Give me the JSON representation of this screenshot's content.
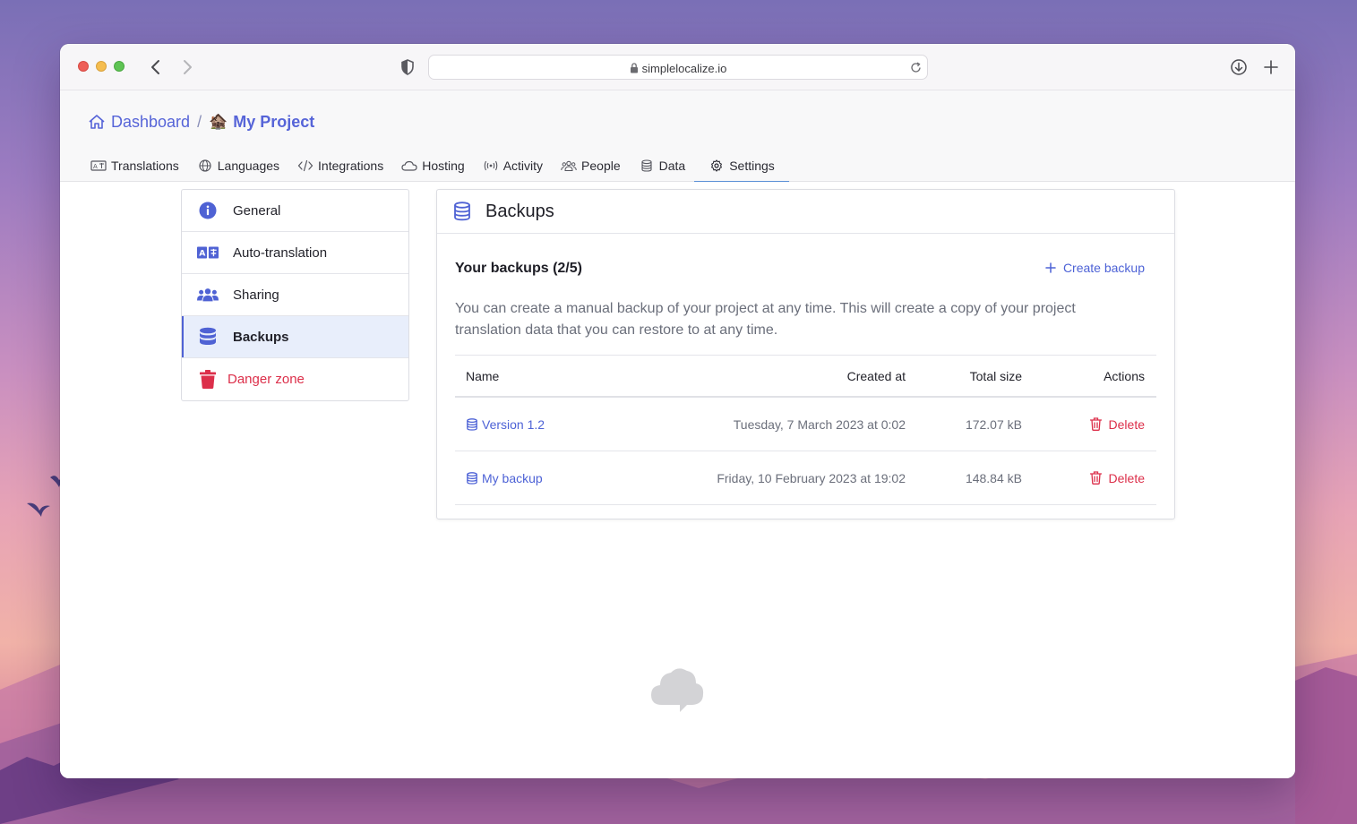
{
  "browser": {
    "url": "simplelocalize.io"
  },
  "header": {
    "breadcrumb_dashboard": "Dashboard",
    "breadcrumb_separator": "/",
    "project_emoji": "🏚️",
    "project_name": "My Project"
  },
  "tabs": [
    {
      "label": "Translations",
      "icon": "translate-icon"
    },
    {
      "label": "Languages",
      "icon": "globe-icon"
    },
    {
      "label": "Integrations",
      "icon": "code-icon"
    },
    {
      "label": "Hosting",
      "icon": "cloud-icon"
    },
    {
      "label": "Activity",
      "icon": "broadcast-icon"
    },
    {
      "label": "People",
      "icon": "people-icon"
    },
    {
      "label": "Data",
      "icon": "database-icon"
    },
    {
      "label": "Settings",
      "icon": "gear-icon",
      "active": true
    }
  ],
  "sidebar": {
    "items": [
      {
        "label": "General",
        "icon": "info-icon"
      },
      {
        "label": "Auto-translation",
        "icon": "auto-translate-icon"
      },
      {
        "label": "Sharing",
        "icon": "users-icon"
      },
      {
        "label": "Backups",
        "icon": "database-icon",
        "active": true
      },
      {
        "label": "Danger zone",
        "icon": "trash-icon",
        "danger": true
      }
    ]
  },
  "panel": {
    "title": "Backups",
    "section_title": "Your backups (2/5)",
    "create_label": "Create backup",
    "description": "You can create a manual backup of your project at any time. This will create a copy of your project translation data that you can restore to at any time.",
    "table": {
      "columns": [
        "Name",
        "Created at",
        "Total size",
        "Actions"
      ],
      "rows": [
        {
          "name": "Version 1.2",
          "created": "Tuesday, 7 March 2023 at 0:02",
          "size": "172.07 kB",
          "action": "Delete"
        },
        {
          "name": "My backup",
          "created": "Friday, 10 February 2023 at 19:02",
          "size": "148.84 kB",
          "action": "Delete"
        }
      ]
    }
  },
  "colors": {
    "accent": "#5664d8",
    "danger": "#dc2f4a",
    "active_tab_underline": "#5b8fd6",
    "active_item_bg": "#e8eefb"
  }
}
